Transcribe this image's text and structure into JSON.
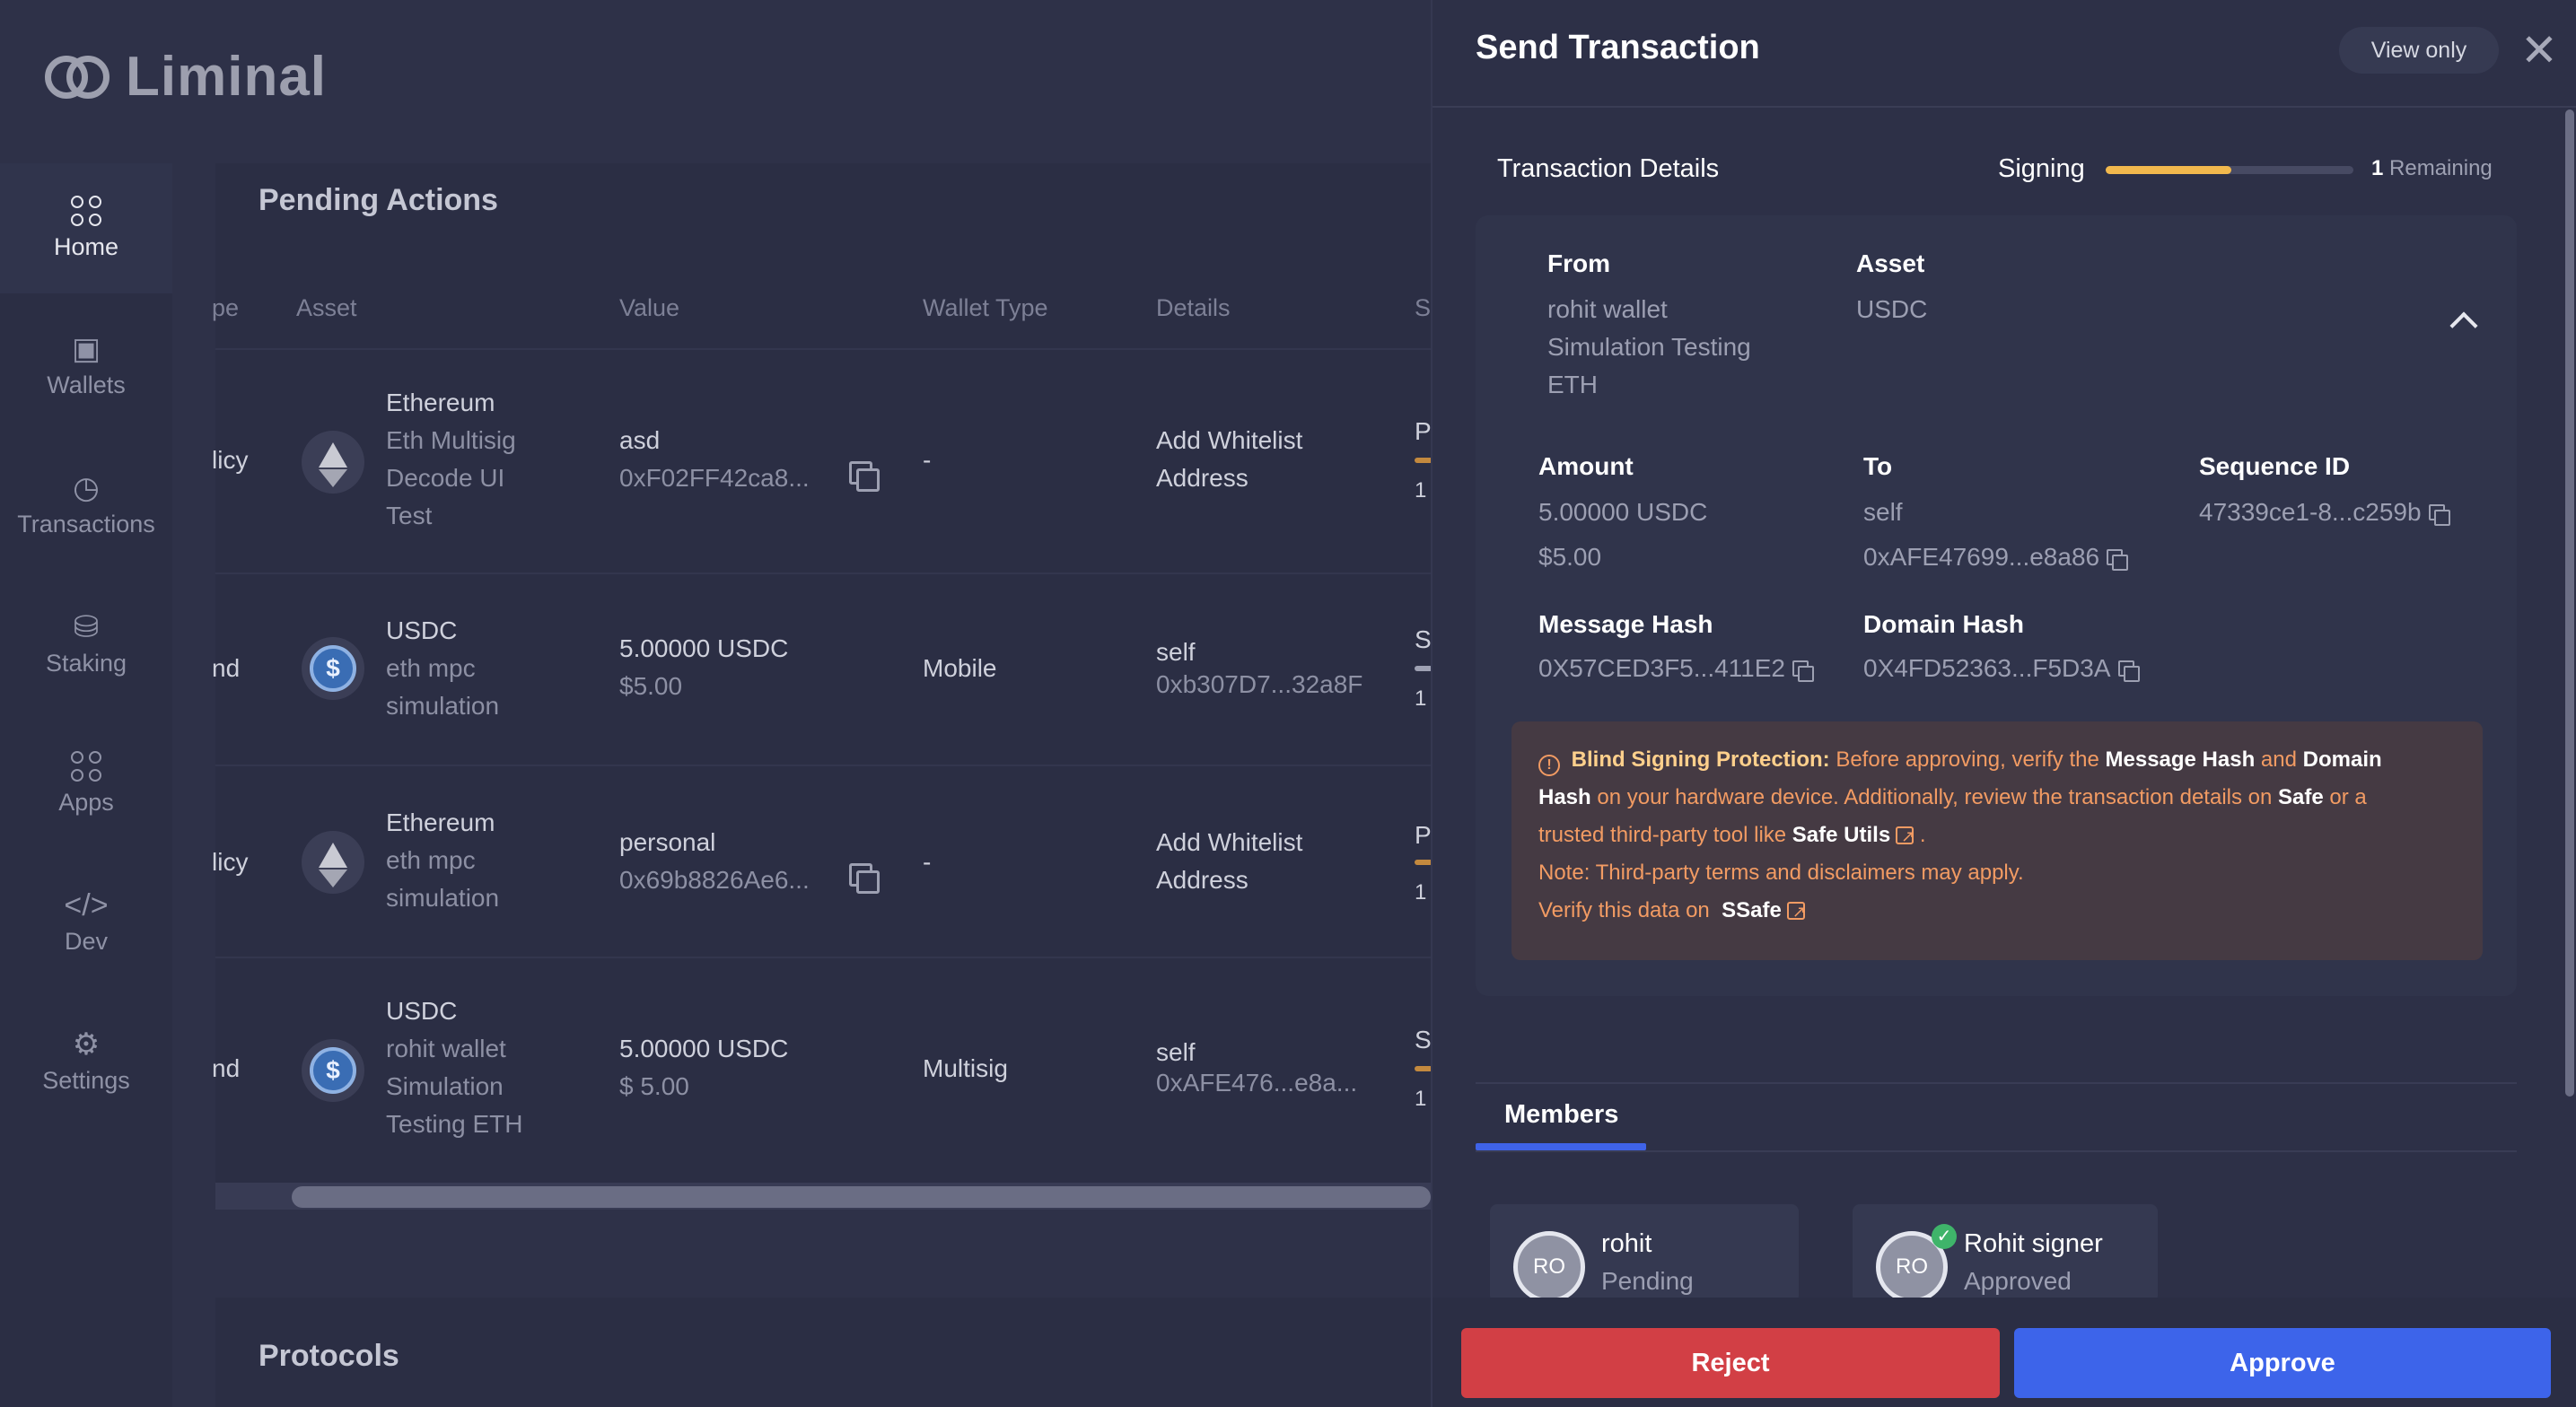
{
  "brand": {
    "name": "Liminal"
  },
  "sidebar": {
    "items": [
      {
        "label": "Home",
        "icon": "home-grid-icon",
        "active": true
      },
      {
        "label": "Wallets",
        "icon": "wallet-icon"
      },
      {
        "label": "Transactions",
        "icon": "clock-icon"
      },
      {
        "label": "Staking",
        "icon": "staking-hand-icon"
      },
      {
        "label": "Apps",
        "icon": "apps-grid-icon"
      },
      {
        "label": "Dev",
        "icon": "code-icon"
      },
      {
        "label": "Settings",
        "icon": "gear-icon"
      }
    ]
  },
  "pending": {
    "title": "Pending Actions",
    "columns": [
      "pe",
      "Asset",
      "Value",
      "Wallet Type",
      "Details",
      "S"
    ],
    "rows": [
      {
        "type": "licy",
        "asset_name": "Ethereum",
        "asset_sub": "Eth Multisig Decode UI Test",
        "asset_icon": "eth",
        "value": "asd",
        "value_sub": "0xF02FF42ca8...",
        "copy": true,
        "wallet_type": "-",
        "details": "Add Whitelist Address",
        "details_sub": "",
        "status": "P",
        "status_sub": "1"
      },
      {
        "type": "nd",
        "asset_name": "USDC",
        "asset_sub": "eth mpc simulation",
        "asset_icon": "usdc",
        "value": "5.00000 USDC",
        "value_sub": "$5.00",
        "copy": false,
        "wallet_type": "Mobile",
        "details": "self",
        "details_sub": "0xb307D7...32a8F",
        "status": "S",
        "status_sub": "1"
      },
      {
        "type": "licy",
        "asset_name": "Ethereum",
        "asset_sub": "eth mpc simulation",
        "asset_icon": "eth",
        "value": "personal",
        "value_sub": "0x69b8826Ae6...",
        "copy": true,
        "wallet_type": "-",
        "details": "Add Whitelist Address",
        "details_sub": "",
        "status": "P",
        "status_sub": "1"
      },
      {
        "type": "nd",
        "asset_name": "USDC",
        "asset_sub": "rohit wallet Simulation Testing ETH",
        "asset_icon": "usdc",
        "value": "5.00000 USDC",
        "value_sub": "$ 5.00",
        "copy": false,
        "wallet_type": "Multisig",
        "details": "self",
        "details_sub": "0xAFE476...e8a...",
        "status": "S",
        "status_sub": "1"
      }
    ]
  },
  "protocols": {
    "title": "Protocols"
  },
  "drawer": {
    "title": "Send Transaction",
    "view_only": "View only",
    "close_glyph": "✕",
    "section_title": "Transaction Details",
    "signing_label": "Signing",
    "signing_progress": 0.5,
    "remaining_count": "1",
    "remaining_label": "Remaining",
    "from_label": "From",
    "from_value": [
      "rohit wallet",
      "Simulation Testing",
      "ETH"
    ],
    "asset_label": "Asset",
    "asset_value": "USDC",
    "amount_label": "Amount",
    "amount_value": "5.00000 USDC",
    "amount_usd": "$5.00",
    "to_label": "To",
    "to_value": "self",
    "to_address": "0xAFE47699...e8a86",
    "sequence_label": "Sequence ID",
    "sequence_value": "47339ce1-8...c259b",
    "message_hash_label": "Message Hash",
    "message_hash_value": "0X57CED3F5...411E2",
    "domain_hash_label": "Domain Hash",
    "domain_hash_value": "0X4FD52363...F5D3A",
    "warning": {
      "heading": "Blind Signing Protection:",
      "text1": "Before approving, verify the",
      "message_hash": "Message Hash",
      "and": "and",
      "domain": "Domain",
      "hash": "Hash",
      "text2": "on your hardware device. Additionally, review the transaction details on",
      "safe": "Safe",
      "or_a": "or a",
      "text3": "trusted third-party tool like",
      "safe_utils": "Safe Utils",
      "period": ".",
      "note": "Note: Third-party terms and disclaimers may apply.",
      "verify": "Verify this data on",
      "safe_brand": "Safe"
    },
    "members_tab": "Members",
    "members": [
      {
        "initials": "RO",
        "name": "rohit",
        "status": "Pending",
        "approved": false
      },
      {
        "initials": "RO",
        "name": "Rohit signer",
        "status": "Approved",
        "approved": true
      }
    ],
    "reject": "Reject",
    "approve": "Approve"
  }
}
